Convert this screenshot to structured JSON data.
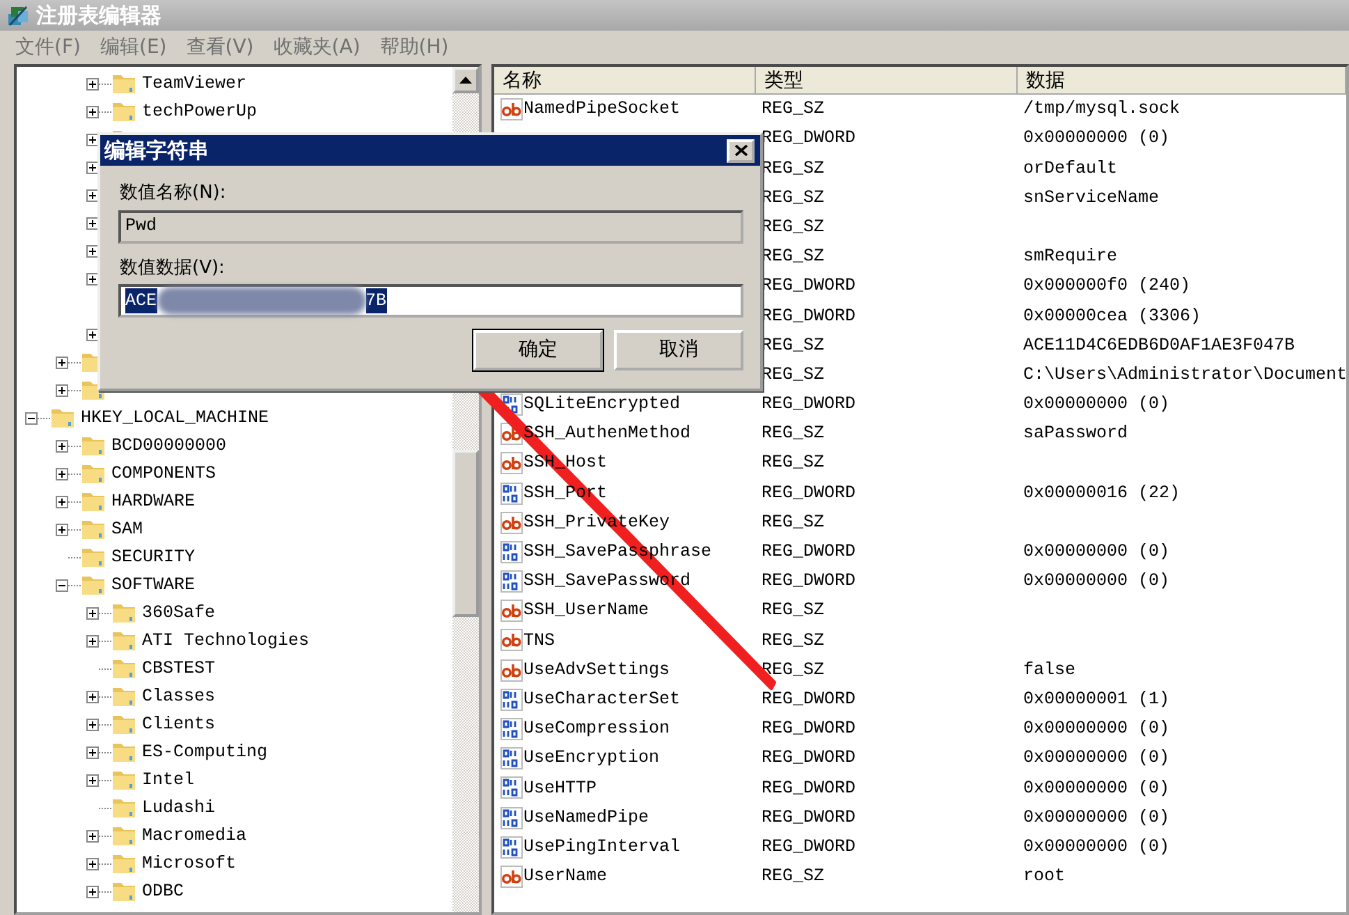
{
  "window": {
    "title": "注册表编辑器"
  },
  "menu": [
    "文件(F)",
    "编辑(E)",
    "查看(V)",
    "收藏夹(A)",
    "帮助(H)"
  ],
  "tree": {
    "nodes": [
      {
        "children": [
          {
            "children": [
              {
                "label": "TeamViewer",
                "expandable": true,
                "expanded": false
              },
              {
                "label": "techPowerUp",
                "expandable": true,
                "expanded": false
              },
              {
                "expandable": true,
                "expanded": false
              },
              {
                "expandable": true,
                "expanded": false
              },
              {
                "expandable": true,
                "expanded": false
              },
              {
                "expandable": true,
                "expanded": false
              },
              {
                "expandable": true,
                "expanded": false
              },
              {
                "expandable": true,
                "expanded": false
              },
              {
                "expandable": false
              },
              {
                "expandable": true,
                "expanded": false
              }
            ]
          },
          {
            "expandable": true,
            "expanded": false
          },
          {
            "expandable": true,
            "expanded": false
          }
        ]
      },
      {
        "label": "HKEY_LOCAL_MACHINE",
        "expandable": true,
        "expanded": true,
        "children": [
          {
            "label": "BCD00000000",
            "expandable": true,
            "expanded": false
          },
          {
            "label": "COMPONENTS",
            "expandable": true,
            "expanded": false
          },
          {
            "label": "HARDWARE",
            "expandable": true,
            "expanded": false
          },
          {
            "label": "SAM",
            "expandable": true,
            "expanded": false
          },
          {
            "label": "SECURITY",
            "expandable": false
          },
          {
            "label": "SOFTWARE",
            "expandable": true,
            "expanded": true,
            "children": [
              {
                "label": "360Safe",
                "expandable": true,
                "expanded": false
              },
              {
                "label": "ATI Technologies",
                "expandable": true,
                "expanded": false
              },
              {
                "label": "CBSTEST",
                "expandable": false
              },
              {
                "label": "Classes",
                "expandable": true,
                "expanded": false
              },
              {
                "label": "Clients",
                "expandable": true,
                "expanded": false
              },
              {
                "label": "ES-Computing",
                "expandable": true,
                "expanded": false
              },
              {
                "label": "Intel",
                "expandable": true,
                "expanded": false
              },
              {
                "label": "Ludashi",
                "expandable": false
              },
              {
                "label": "Macromedia",
                "expandable": true,
                "expanded": false
              },
              {
                "label": "Microsoft",
                "expandable": true,
                "expanded": false
              },
              {
                "label": "ODBC",
                "expandable": true,
                "expanded": false
              }
            ]
          }
        ]
      }
    ]
  },
  "table": {
    "columns": [
      "名称",
      "类型",
      "数据"
    ],
    "rows": [
      {
        "kind": "string",
        "name": "NamedPipeSocket",
        "type": "REG_SZ",
        "data": "/tmp/mysql.sock"
      },
      {
        "type": "REG_DWORD",
        "data": "0x00000000 (0)"
      },
      {
        "type": "REG_SZ",
        "data": "orDefault"
      },
      {
        "type": "REG_SZ",
        "data": "snServiceName"
      },
      {
        "type": "REG_SZ"
      },
      {
        "type": "REG_SZ",
        "data": "smRequire"
      },
      {
        "type": "REG_DWORD",
        "data": "0x000000f0 (240)"
      },
      {
        "type": "REG_DWORD",
        "data": "0x00000cea (3306)"
      },
      {
        "type": "REG_SZ",
        "data": "ACE11D4C6EDB6D0AF1AE3F047B"
      },
      {
        "type": "REG_SZ",
        "data": "C:\\Users\\Administrator\\Document"
      },
      {
        "kind": "binary",
        "name": "SQLiteEncrypted",
        "type": "REG_DWORD",
        "data": "0x00000000 (0)"
      },
      {
        "kind": "string",
        "name": "SSH_AuthenMethod",
        "type": "REG_SZ",
        "data": "saPassword"
      },
      {
        "kind": "string",
        "name": "SSH_Host",
        "type": "REG_SZ"
      },
      {
        "kind": "binary",
        "name": "SSH_Port",
        "type": "REG_DWORD",
        "data": "0x00000016 (22)"
      },
      {
        "kind": "string",
        "name": "SSH_PrivateKey",
        "type": "REG_SZ"
      },
      {
        "kind": "binary",
        "name": "SSH_SavePassphrase",
        "type": "REG_DWORD",
        "data": "0x00000000 (0)"
      },
      {
        "kind": "binary",
        "name": "SSH_SavePassword",
        "type": "REG_DWORD",
        "data": "0x00000000 (0)"
      },
      {
        "kind": "string",
        "name": "SSH_UserName",
        "type": "REG_SZ"
      },
      {
        "kind": "string",
        "name": "TNS",
        "type": "REG_SZ"
      },
      {
        "kind": "string",
        "name": "UseAdvSettings",
        "type": "REG_SZ",
        "data": "false"
      },
      {
        "kind": "binary",
        "name": "UseCharacterSet",
        "type": "REG_DWORD",
        "data": "0x00000001 (1)"
      },
      {
        "kind": "binary",
        "name": "UseCompression",
        "type": "REG_DWORD",
        "data": "0x00000000 (0)"
      },
      {
        "kind": "binary",
        "name": "UseEncryption",
        "type": "REG_DWORD",
        "data": "0x00000000 (0)"
      },
      {
        "kind": "binary",
        "name": "UseHTTP",
        "type": "REG_DWORD",
        "data": "0x00000000 (0)"
      },
      {
        "kind": "binary",
        "name": "UseNamedPipe",
        "type": "REG_DWORD",
        "data": "0x00000000 (0)"
      },
      {
        "kind": "binary",
        "name": "UsePingInterval",
        "type": "REG_DWORD",
        "data": "0x00000000 (0)"
      },
      {
        "kind": "string",
        "name": "UserName",
        "type": "REG_SZ",
        "data": "root"
      }
    ]
  },
  "dialog": {
    "title": "编辑字符串",
    "name_label": "数值名称(N):",
    "name_value": "Pwd",
    "data_label": "数值数据(V):",
    "data_value_start": "ACE",
    "data_value_end": "7B",
    "buttons": [
      {
        "label": "确定",
        "default": true
      },
      {
        "label": "取消",
        "default": false
      }
    ]
  }
}
